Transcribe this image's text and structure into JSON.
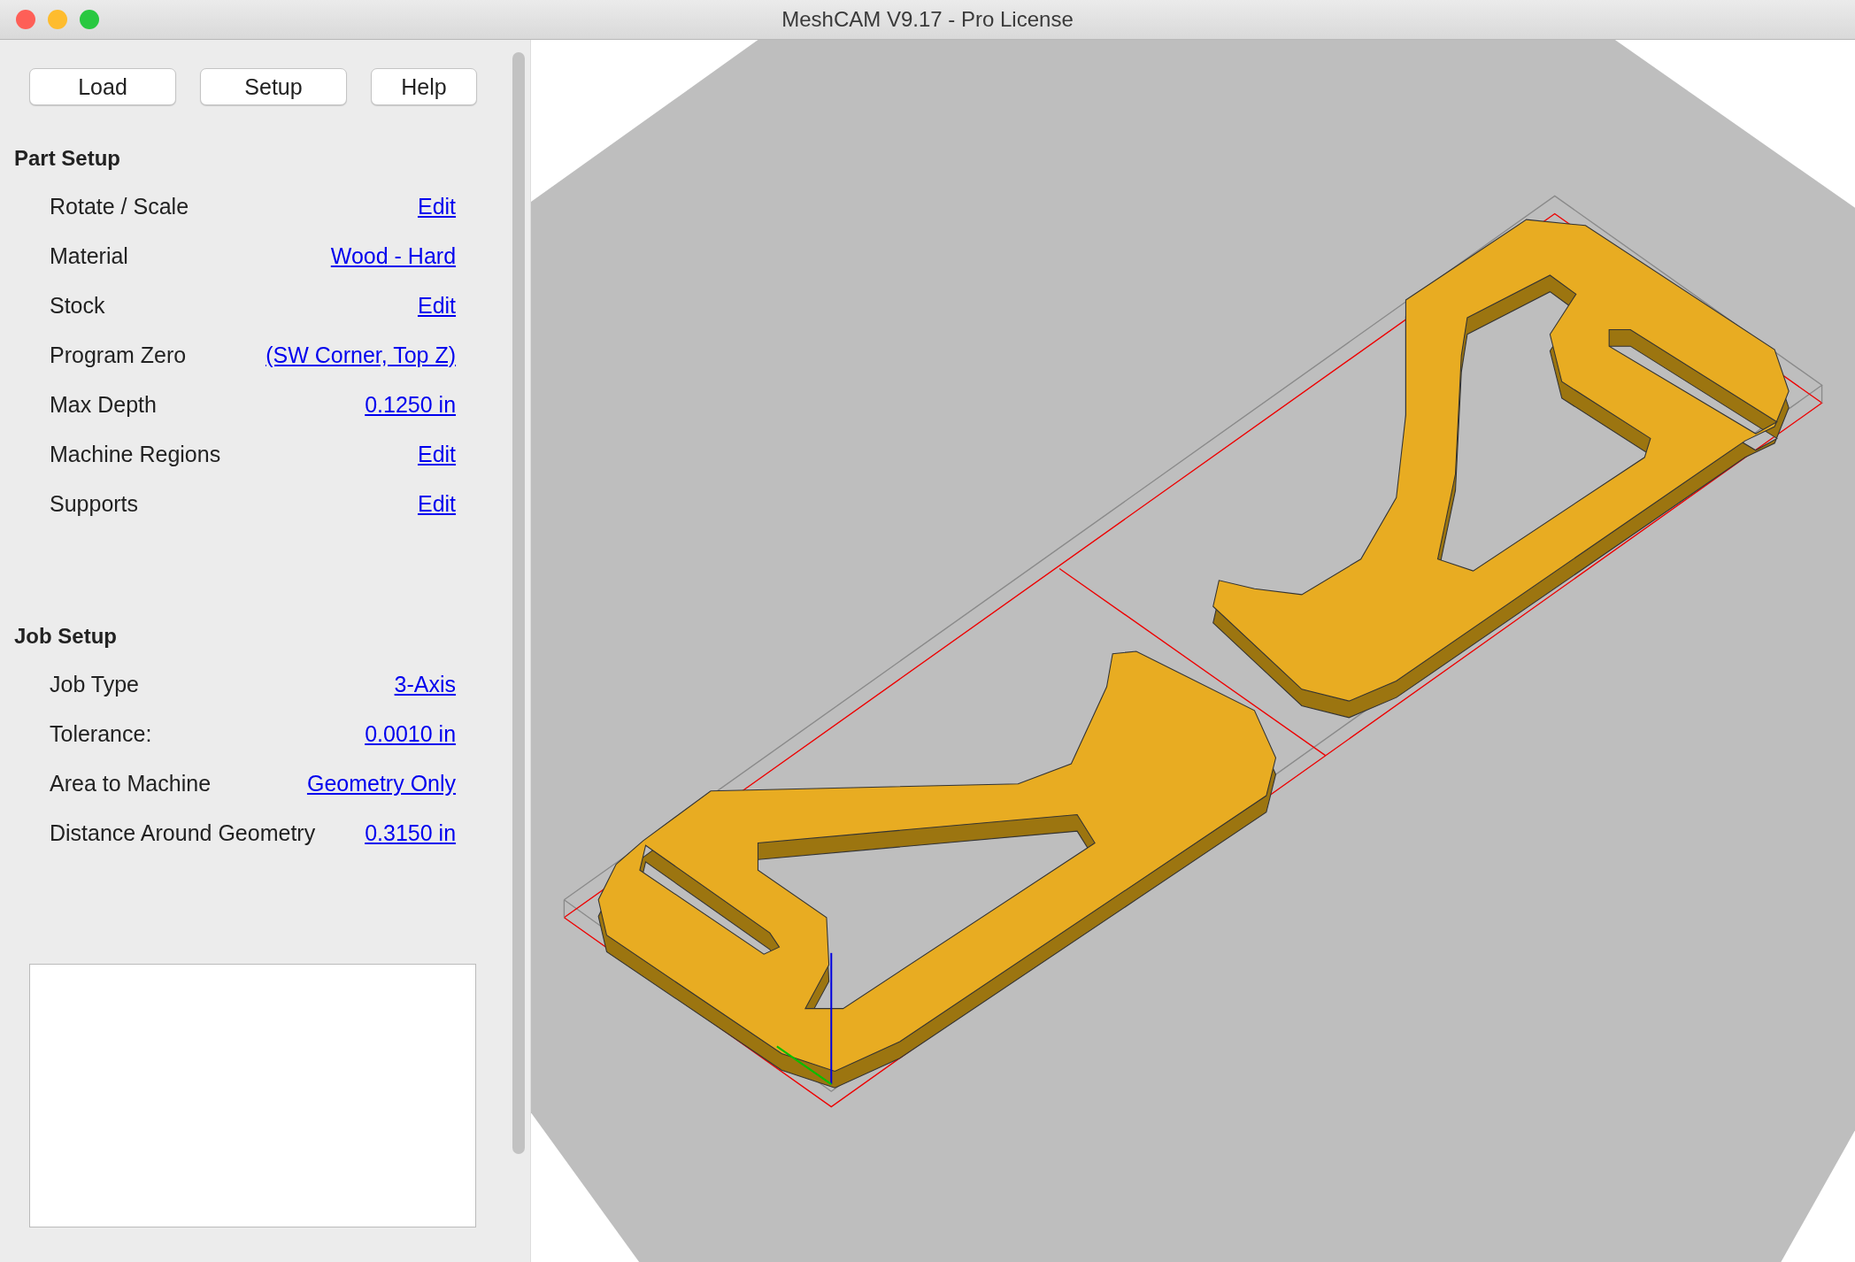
{
  "window": {
    "title": "MeshCAM V9.17 - Pro License"
  },
  "toolbar": [
    "Load",
    "Setup",
    "Help"
  ],
  "sections": [
    {
      "title": "Part Setup",
      "rows": [
        {
          "label": "Rotate / Scale",
          "value": "Edit"
        },
        {
          "label": "Material",
          "value": "Wood - Hard"
        },
        {
          "label": "Stock",
          "value": "Edit"
        },
        {
          "label": "Program Zero",
          "value": "(SW Corner, Top Z)"
        },
        {
          "label": "Max Depth",
          "value": "0.1250 in"
        },
        {
          "label": "Machine Regions",
          "value": "Edit"
        },
        {
          "label": "Supports",
          "value": "Edit"
        }
      ]
    },
    {
      "title": "Job Setup",
      "rows": [
        {
          "label": "Job Type",
          "value": "3-Axis"
        },
        {
          "label": "Tolerance:",
          "value": "0.0010 in"
        },
        {
          "label": "Area to Machine",
          "value": "Geometry Only"
        },
        {
          "label": "Distance Around Geometry",
          "value": "0.3150 in"
        }
      ]
    }
  ]
}
